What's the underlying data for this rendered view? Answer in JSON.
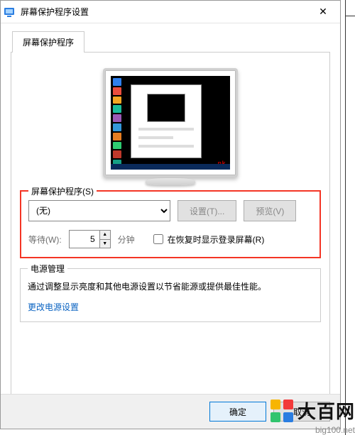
{
  "window": {
    "title": "屏幕保护程序设置"
  },
  "tab": "屏幕保护程序",
  "screensaver": {
    "group_title": "屏幕保护程序(S)",
    "selected": "(无)",
    "settings_btn": "设置(T)...",
    "preview_btn": "预览(V)",
    "wait_label": "等待(W):",
    "wait_value": "5",
    "wait_unit": "分钟",
    "resume_checkbox": "在恢复时显示登录屏幕(R)"
  },
  "power": {
    "group_title": "电源管理",
    "desc": "通过调整显示亮度和其他电源设置以节省能源或提供最佳性能。",
    "link": "更改电源设置"
  },
  "footer": {
    "ok": "确定",
    "cancel": "取消"
  },
  "icon_colors": [
    "#2f80ed",
    "#eb4d3d",
    "#f5a623",
    "#1abc9c",
    "#9b59b6",
    "#3498db",
    "#e67e22",
    "#2ecc71",
    "#c0392b",
    "#16a085"
  ],
  "watermark": {
    "brand": "大百网",
    "url": "big100.net",
    "sq": [
      "#f7b500",
      "#f23a3a",
      "#31c46e",
      "#2a7de1"
    ]
  }
}
